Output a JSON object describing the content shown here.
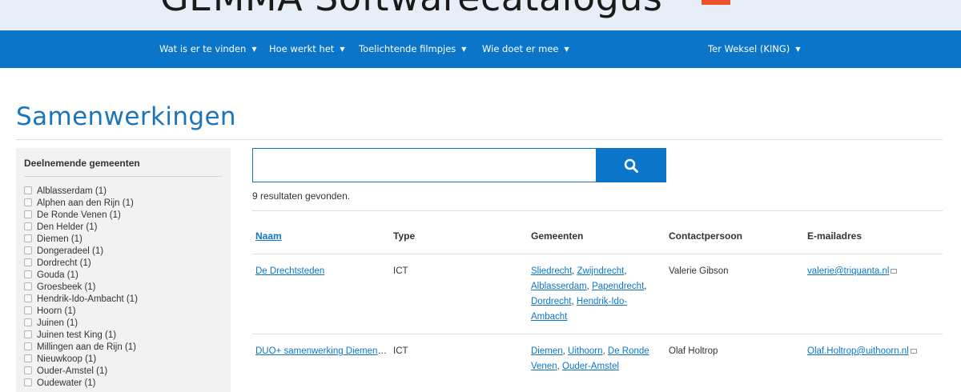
{
  "banner": {
    "title": "GEMMA Softwarecatalogus"
  },
  "nav": {
    "items": [
      {
        "label": "Wat is er te vinden"
      },
      {
        "label": "Hoe werkt het"
      },
      {
        "label": "Toelichtende filmpjes"
      },
      {
        "label": "Wie doet er mee"
      }
    ],
    "user": {
      "label": "Ter Weksel (KING)"
    }
  },
  "page": {
    "title": "Samenwerkingen"
  },
  "sidebar": {
    "heading": "Deelnemende gemeenten",
    "filters": [
      "Alblasserdam (1)",
      "Alphen aan den Rijn (1)",
      "De Ronde Venen (1)",
      "Den Helder (1)",
      "Diemen (1)",
      "Dongeradeel (1)",
      "Dordrecht (1)",
      "Gouda (1)",
      "Groesbeek (1)",
      "Hendrik-Ido-Ambacht (1)",
      "Hoorn (1)",
      "Juinen (1)",
      "Juinen test King (1)",
      "Millingen aan de Rijn (1)",
      "Nieuwkoop (1)",
      "Ouder-Amstel (1)",
      "Oudewater (1)"
    ]
  },
  "search": {
    "value": "",
    "placeholder": ""
  },
  "results": {
    "count_text": "9 resultaten gevonden.",
    "columns": [
      "Naam",
      "Type",
      "Gemeenten",
      "Contactpersoon",
      "E-mailadres"
    ],
    "rows": [
      {
        "name": "De Drechtsteden",
        "type": "ICT",
        "gemeenten": [
          "Sliedrecht",
          "Zwijndrecht",
          "Alblasserdam",
          "Papendrecht",
          "Dordrecht",
          "Hendrik-Ido-Ambacht"
        ],
        "contact": "Valerie Gibson",
        "email": "valerie@triquanta.nl"
      },
      {
        "name": "DUO+ samenwerking Diemen, Ouder-Amstel, Uithoorn",
        "type": "ICT",
        "gemeenten": [
          "Diemen",
          "Uithoorn",
          "De Ronde Venen",
          "Ouder-Amstel"
        ],
        "contact": "Olaf Holtrop",
        "email": "Olaf.Holtrop@uithoorn.nl"
      }
    ]
  },
  "colors": {
    "brand_blue": "#0b76c9",
    "title_blue": "#1a75bb",
    "accent_orange": "#f0522e"
  },
  "icons": {
    "search": "magnifier-icon",
    "mail": "external-mail-icon"
  }
}
